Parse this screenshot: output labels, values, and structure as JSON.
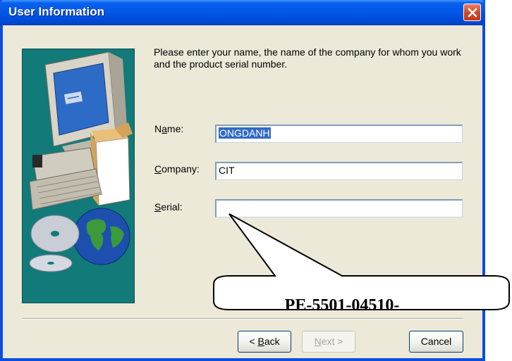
{
  "window": {
    "title": "User Information"
  },
  "intro_text": "Please enter your name, the name of the company for whom you work and the product serial number.",
  "fields": {
    "name": {
      "label_prefix": "N",
      "label_mnemonic": "a",
      "label_suffix": "me:",
      "value": "ONGDANH"
    },
    "company": {
      "label_prefix": "",
      "label_mnemonic": "C",
      "label_suffix": "ompany:",
      "value": "CIT"
    },
    "serial": {
      "label_prefix": "",
      "label_mnemonic": "S",
      "label_suffix": "erial:",
      "value": ""
    }
  },
  "buttons": {
    "back": {
      "prefix": "< ",
      "mnemonic": "B",
      "suffix": "ack"
    },
    "next": {
      "prefix": "",
      "mnemonic": "N",
      "suffix": "ext >"
    },
    "cancel": {
      "label": "Cancel"
    }
  },
  "callout": {
    "text": "PE-5501-04510-"
  },
  "colors": {
    "titlebar": "#0056e6",
    "dialog_bg": "#ece9d8",
    "image_panel": "#127a78",
    "selection": "#316ac5"
  },
  "icons": {
    "close": "close-icon",
    "artwork": "computer-globe-illustration"
  }
}
